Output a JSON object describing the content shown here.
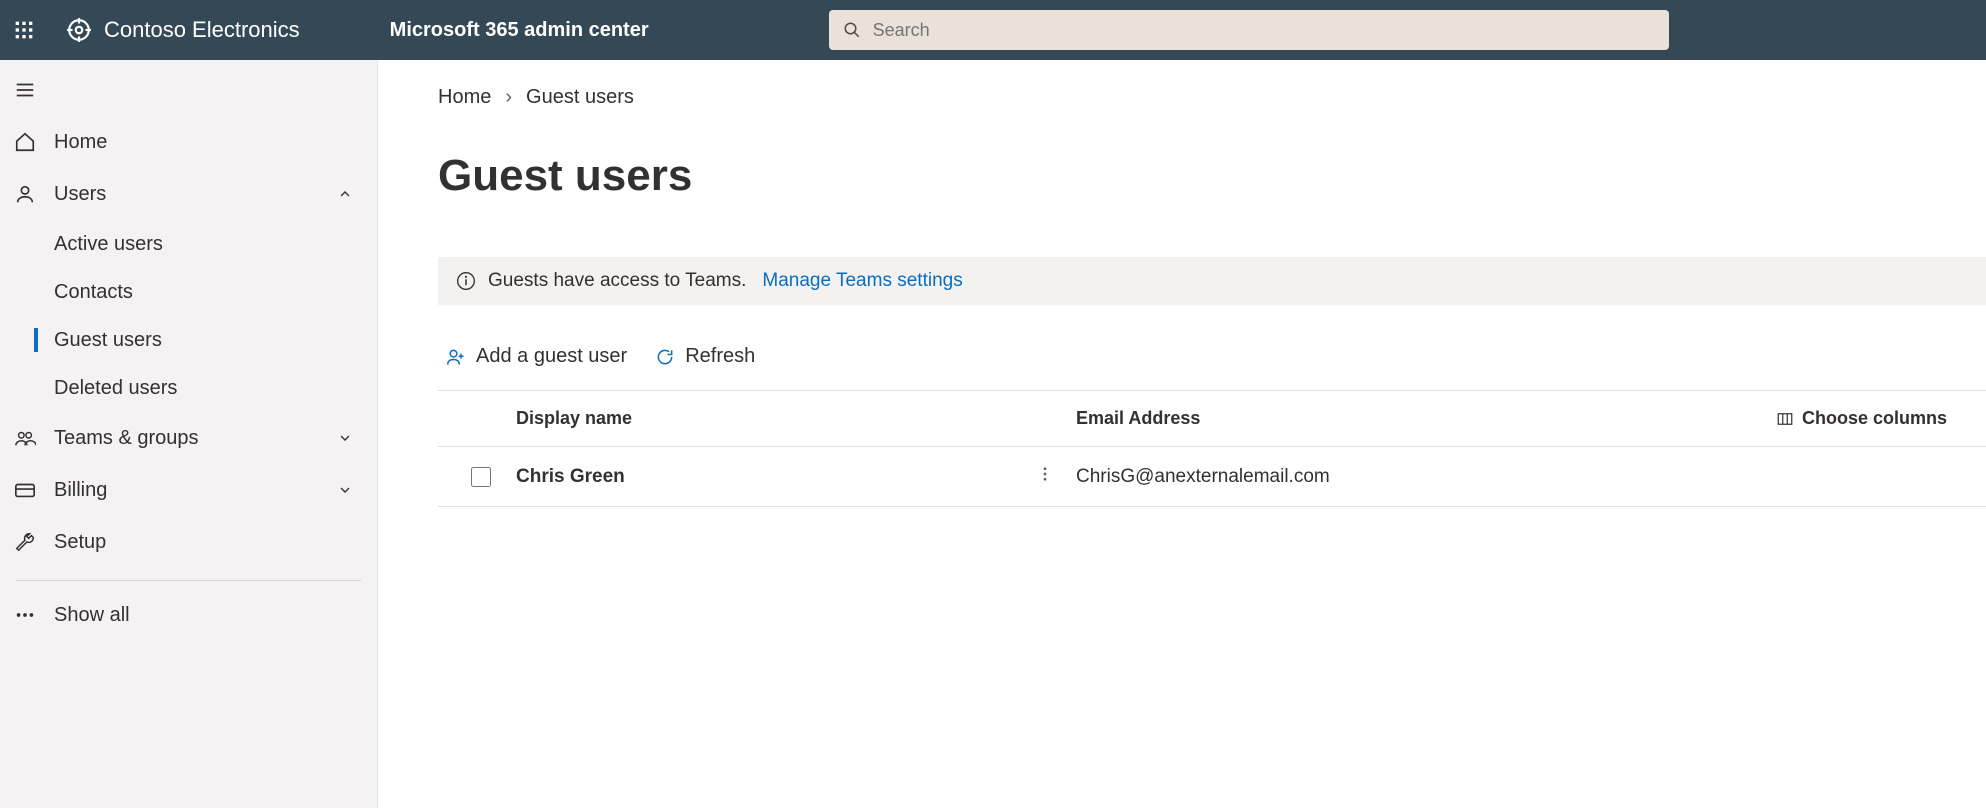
{
  "header": {
    "tenant_name": "Contoso Electronics",
    "app_title": "Microsoft 365 admin center",
    "search_placeholder": "Search"
  },
  "sidebar": {
    "home": "Home",
    "users": "Users",
    "users_children": {
      "active_users": "Active users",
      "contacts": "Contacts",
      "guest_users": "Guest users",
      "deleted_users": "Deleted users"
    },
    "teams_groups": "Teams & groups",
    "billing": "Billing",
    "setup": "Setup",
    "show_all": "Show all"
  },
  "breadcrumb": {
    "home": "Home",
    "current": "Guest users"
  },
  "page": {
    "title": "Guest users",
    "banner_text": "Guests have access to Teams.",
    "banner_link": "Manage Teams settings"
  },
  "commands": {
    "add_guest": "Add a guest user",
    "refresh": "Refresh"
  },
  "table": {
    "col_display_name": "Display name",
    "col_email": "Email Address",
    "choose_columns": "Choose columns",
    "rows": [
      {
        "display_name": "Chris  Green",
        "email": "ChrisG@anexternalemail.com"
      }
    ]
  }
}
